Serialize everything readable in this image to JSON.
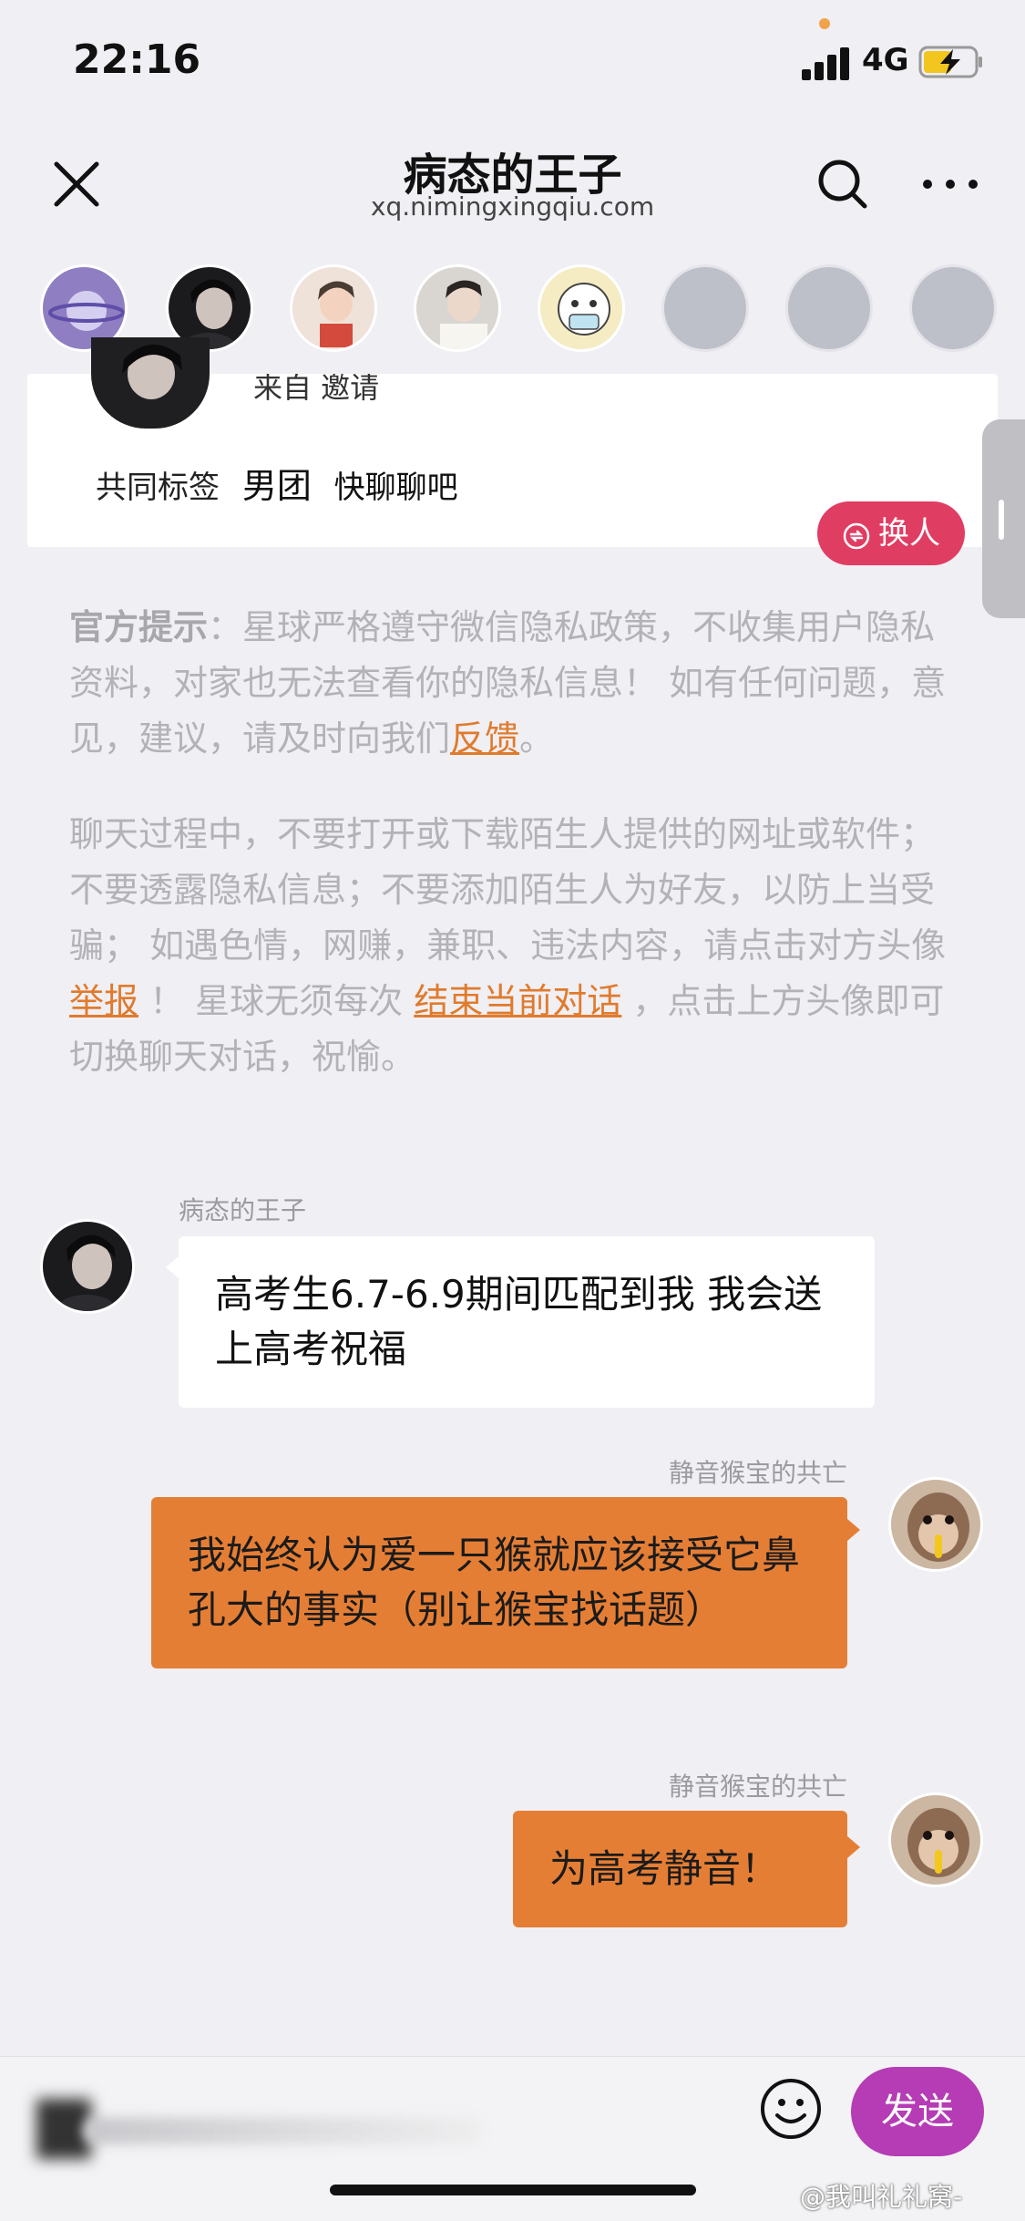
{
  "status_bar": {
    "time": "22:16",
    "network": "4G",
    "battery_charging": true
  },
  "header": {
    "title": "病态的王子",
    "subtitle": "xq.nimingxingqiu.com"
  },
  "avatar_strip": {
    "items": [
      {
        "name": "planet"
      },
      {
        "name": "dark-hair-boy"
      },
      {
        "name": "boy-with-cup"
      },
      {
        "name": "boy-white-shirt"
      },
      {
        "name": "cartoon-mask"
      },
      {
        "name": "empty"
      },
      {
        "name": "empty"
      },
      {
        "name": "empty"
      }
    ]
  },
  "match_card": {
    "from_text": "来自 邀请",
    "tags_label": "共同标签",
    "tags": [
      "男团",
      "快聊聊吧"
    ]
  },
  "switch_button": {
    "label": "换人"
  },
  "notices": {
    "official_prefix": "官方提示",
    "official_text": "：星球严格遵守微信隐私政策，不收集用户隐私资料，对家也无法查看你的隐私信息！ 如有任何问题，意见，建议，请及时向我们",
    "feedback_link": "反馈",
    "official_end": "。",
    "safety_text_1": "聊天过程中，不要打开或下载陌生人提供的网址或软件；不要透露隐私信息；不要添加陌生人为好友，以防上当受骗； 如遇色情，网赚，兼职、违法内容，请点击对方头像 ",
    "report_link": "举报",
    "safety_text_2": " ！ 星球无须每次 ",
    "end_chat_link": "结束当前对话",
    "safety_text_3": " ，点击上方头像即可切换聊天对话，祝愉。"
  },
  "messages": [
    {
      "side": "left",
      "sender": "病态的王子",
      "text": "高考生6.7-6.9期间匹配到我 我会送上高考祝福"
    },
    {
      "side": "right",
      "sender": "静音猴宝的共亡",
      "text": "我始终认为爱一只猴就应该接受它鼻孔大的事实（别让猴宝找话题）"
    },
    {
      "side": "right",
      "sender": "静音猴宝的共亡",
      "text": "为高考静音！"
    }
  ],
  "input_bar": {
    "send_label": "发送"
  },
  "watermark": "@我叫礼礼窝-",
  "colors": {
    "accent_orange": "#e57e35",
    "switch_red": "#e03d63",
    "send_purple": "#b53cb4",
    "link_orange": "#e07b2d"
  }
}
